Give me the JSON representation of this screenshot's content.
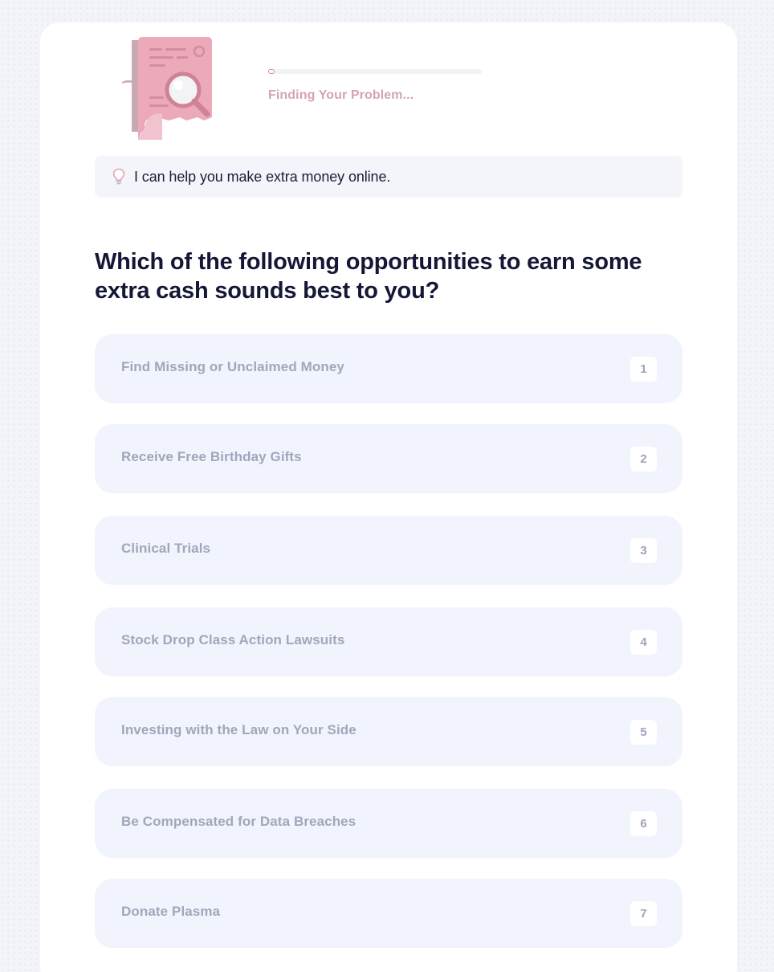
{
  "progress": {
    "status_text": "Finding Your Problem...",
    "fraction": 0.02
  },
  "hint": {
    "icon": "lightbulb-icon",
    "text": "I can help you make extra money online."
  },
  "question": "Which of the following opportunities to earn some extra cash sounds best to you?",
  "options": [
    {
      "label": "Find Missing or Unclaimed Money",
      "key": "1"
    },
    {
      "label": "Receive Free Birthday Gifts",
      "key": "2"
    },
    {
      "label": "Clinical Trials",
      "key": "3"
    },
    {
      "label": "Stock Drop Class Action Lawsuits",
      "key": "4"
    },
    {
      "label": "Investing with the Law on Your Side",
      "key": "5"
    },
    {
      "label": "Be Compensated for Data Breaches",
      "key": "6"
    },
    {
      "label": "Donate Plasma",
      "key": "7"
    }
  ],
  "colors": {
    "accent_pink": "#e8a8b8",
    "question_text": "#141735",
    "option_background": "#f1f4fd",
    "option_text": "#a2a6b9"
  }
}
